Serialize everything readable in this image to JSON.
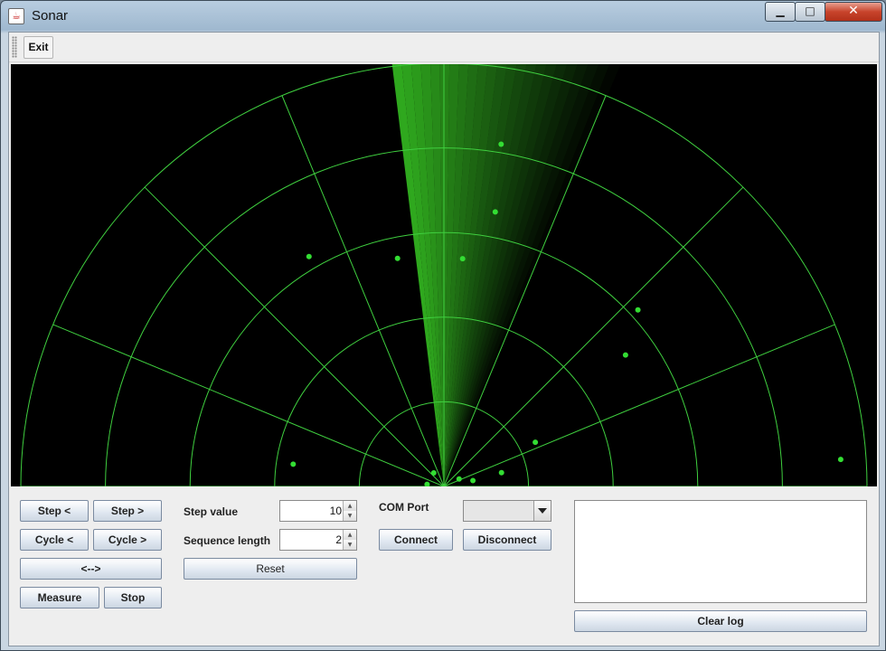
{
  "window": {
    "title": "Sonar",
    "app_icon": "java-cup-icon",
    "min_glyph": "▁",
    "max_glyph": "□",
    "close_glyph": "✕"
  },
  "toolbar": {
    "exit_label": "Exit"
  },
  "radar": {
    "colors": {
      "background": "#000000",
      "grid": "#3fcf3f",
      "beam": "#2fa81e",
      "target": "#33dd33"
    },
    "sweep_bearing_deg": 4,
    "targets": [
      {
        "bearing_deg": 9.5,
        "range_frac": 0.82
      },
      {
        "bearing_deg": 10.6,
        "range_frac": 0.66
      },
      {
        "bearing_deg": 4.7,
        "range_frac": 0.54
      },
      {
        "bearing_deg": -11.5,
        "range_frac": 0.55
      },
      {
        "bearing_deg": -30.4,
        "range_frac": 0.63
      },
      {
        "bearing_deg": 47.7,
        "range_frac": 0.62
      },
      {
        "bearing_deg": 54.1,
        "range_frac": 0.53
      },
      {
        "bearing_deg": 64.2,
        "range_frac": 0.24
      },
      {
        "bearing_deg": 76.5,
        "range_frac": 0.14
      },
      {
        "bearing_deg": 63.6,
        "range_frac": 0.04
      },
      {
        "bearing_deg": 78.6,
        "range_frac": 0.07
      },
      {
        "bearing_deg": -36.7,
        "range_frac": 0.04
      },
      {
        "bearing_deg": -82.5,
        "range_frac": 0.04
      },
      {
        "bearing_deg": -81.6,
        "range_frac": 0.36
      },
      {
        "bearing_deg": 86.1,
        "range_frac": 0.94
      }
    ]
  },
  "controls": {
    "step_left": "Step <",
    "step_right": "Step >",
    "cycle_left": "Cycle <",
    "cycle_right": "Cycle >",
    "sweep": "<-->",
    "measure": "Measure",
    "stop": "Stop",
    "step_value_label": "Step value",
    "step_value": "10",
    "sequence_length_label": "Sequence length",
    "sequence_length": "2",
    "reset": "Reset",
    "com_port_label": "COM Port",
    "com_port_value": "",
    "connect": "Connect",
    "disconnect": "Disconnect",
    "clear_log": "Clear log"
  },
  "log": {
    "text": ""
  }
}
